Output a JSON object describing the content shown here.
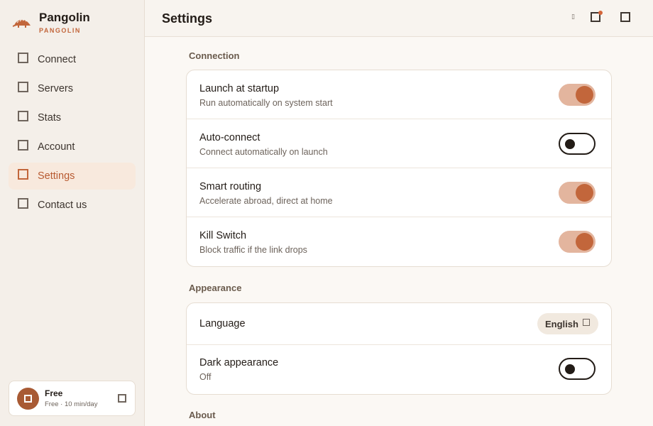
{
  "app": {
    "name": "Pangolin",
    "subtitle": "PANGOLIN"
  },
  "sidebar": {
    "items": [
      {
        "label": "Connect",
        "icon": "connect-icon",
        "active": false
      },
      {
        "label": "Servers",
        "icon": "servers-icon",
        "active": false
      },
      {
        "label": "Stats",
        "icon": "stats-icon",
        "active": false
      },
      {
        "label": "Account",
        "icon": "account-icon",
        "active": false
      },
      {
        "label": "Settings",
        "icon": "settings-icon",
        "active": true
      },
      {
        "label": "Contact us",
        "icon": "contact-icon",
        "active": false
      }
    ],
    "plan": {
      "title": "Free",
      "detail": "Free · 10 min/day"
    }
  },
  "header": {
    "title": "Settings",
    "glyph": "▯"
  },
  "sections": {
    "connection": {
      "title": "Connection",
      "rows": [
        {
          "title": "Launch at startup",
          "subtitle": "Run automatically on system start",
          "enabled": true
        },
        {
          "title": "Auto-connect",
          "subtitle": "Connect automatically on launch",
          "enabled": false
        },
        {
          "title": "Smart routing",
          "subtitle": "Accelerate abroad, direct at home",
          "enabled": true
        },
        {
          "title": "Kill Switch",
          "subtitle": "Block traffic if the link drops",
          "enabled": true
        }
      ]
    },
    "appearance": {
      "title": "Appearance",
      "language": {
        "title": "Language",
        "value": "English"
      },
      "dark": {
        "title": "Dark appearance",
        "subtitle": "Off",
        "enabled": false
      }
    },
    "about": {
      "title": "About"
    }
  },
  "colors": {
    "accent": "#c2663b",
    "toggle_on_track": "#e3b59e",
    "active_nav_bg": "#f8e9dd",
    "sidebar_bg": "#f4efe9",
    "content_bg": "#fbf8f4"
  }
}
